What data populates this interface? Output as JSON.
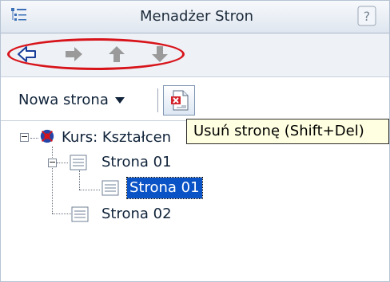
{
  "window": {
    "title": "Menadżer Stron",
    "help_label": "?"
  },
  "nav_toolbar": {
    "buttons": [
      {
        "icon": "arrow-left-icon",
        "enabled": true
      },
      {
        "icon": "arrow-right-icon",
        "enabled": false
      },
      {
        "icon": "arrow-up-icon",
        "enabled": false
      },
      {
        "icon": "arrow-down-icon",
        "enabled": false
      }
    ],
    "highlight_color": "#d8141b"
  },
  "action_toolbar": {
    "new_page_label": "Nowa strona",
    "delete_icon": "delete-page-icon"
  },
  "tooltip": {
    "text": "Usuń stronę (Shift+Del)"
  },
  "tree": {
    "root": {
      "label": "Kurs: Kształcen",
      "icon": "course-icon",
      "expanded": true
    },
    "items": [
      {
        "label": "Strona 01",
        "expanded": true,
        "selected": false
      },
      {
        "label": "Strona 01",
        "selected": true
      },
      {
        "label": "Strona 02",
        "selected": false
      }
    ]
  },
  "colors": {
    "selection": "#0a53c6",
    "tooltip_bg": "#ffffe1"
  }
}
